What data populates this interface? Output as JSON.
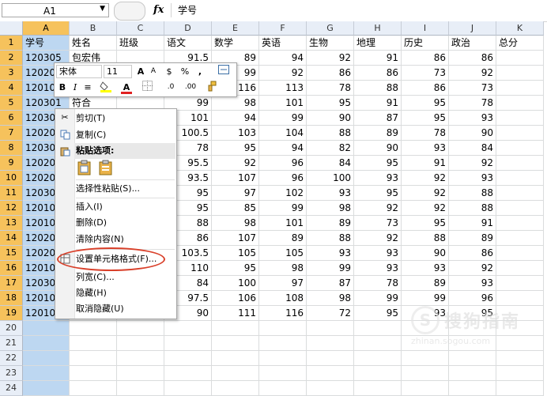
{
  "formula_bar": {
    "name_box": "A1",
    "fx": "fx",
    "content": "学号"
  },
  "columns": [
    "A",
    "B",
    "C",
    "D",
    "E",
    "F",
    "G",
    "H",
    "I",
    "J",
    "K"
  ],
  "rows": [
    "1",
    "2",
    "3",
    "4",
    "5",
    "6",
    "7",
    "8",
    "9",
    "10",
    "11",
    "12",
    "13",
    "14",
    "15",
    "16",
    "17",
    "18",
    "19",
    "20",
    "21",
    "22",
    "23",
    "24"
  ],
  "cells": [
    [
      "学号",
      "姓名",
      "班级",
      "语文",
      "数学",
      "英语",
      "生物",
      "地理",
      "历史",
      "政治",
      "总分"
    ],
    [
      "120305",
      "包宏伟",
      "",
      "91.5",
      "89",
      "94",
      "92",
      "91",
      "86",
      "86",
      ""
    ],
    [
      "120203",
      "",
      "",
      "93",
      "99",
      "92",
      "86",
      "86",
      "73",
      "92",
      ""
    ],
    [
      "120104",
      "",
      "",
      "102",
      "116",
      "113",
      "78",
      "88",
      "86",
      "73",
      ""
    ],
    [
      "120301",
      "符合",
      "",
      "99",
      "98",
      "101",
      "95",
      "91",
      "95",
      "78",
      ""
    ],
    [
      "120306",
      "",
      "",
      "101",
      "94",
      "99",
      "90",
      "87",
      "95",
      "93",
      ""
    ],
    [
      "120206",
      "",
      "",
      "100.5",
      "103",
      "104",
      "88",
      "89",
      "78",
      "90",
      ""
    ],
    [
      "120302",
      "",
      "",
      "78",
      "95",
      "94",
      "82",
      "90",
      "93",
      "84",
      ""
    ],
    [
      "120204",
      "",
      "",
      "95.5",
      "92",
      "96",
      "84",
      "95",
      "91",
      "92",
      ""
    ],
    [
      "120201",
      "",
      "",
      "93.5",
      "107",
      "96",
      "100",
      "93",
      "92",
      "93",
      ""
    ],
    [
      "120304",
      "",
      "",
      "95",
      "97",
      "102",
      "93",
      "95",
      "92",
      "88",
      ""
    ],
    [
      "120103",
      "",
      "",
      "95",
      "85",
      "99",
      "98",
      "92",
      "92",
      "88",
      ""
    ],
    [
      "120105",
      "",
      "",
      "88",
      "98",
      "101",
      "89",
      "73",
      "95",
      "91",
      ""
    ],
    [
      "120202",
      "",
      "",
      "86",
      "107",
      "89",
      "88",
      "92",
      "88",
      "89",
      ""
    ],
    [
      "120205",
      "",
      "",
      "103.5",
      "105",
      "105",
      "93",
      "93",
      "90",
      "86",
      ""
    ],
    [
      "120102",
      "",
      "",
      "110",
      "95",
      "98",
      "99",
      "93",
      "93",
      "92",
      ""
    ],
    [
      "120303",
      "",
      "",
      "84",
      "100",
      "97",
      "87",
      "78",
      "89",
      "93",
      ""
    ],
    [
      "120101",
      "",
      "",
      "97.5",
      "106",
      "108",
      "98",
      "99",
      "99",
      "96",
      ""
    ],
    [
      "120106",
      "",
      "",
      "90",
      "111",
      "116",
      "72",
      "95",
      "93",
      "95",
      ""
    ]
  ],
  "mini_toolbar": {
    "font_name": "宋体",
    "font_size": "11",
    "grow": "A",
    "shrink": "A",
    "currency": "$",
    "percent": "%",
    "comma": ",",
    "bold": "B",
    "italic": "I",
    "font_color_letter": "A",
    "dec_inc": ".0",
    "dec_dec": ".00",
    "highlight_color": "#ffff00",
    "font_color": "#e02020"
  },
  "context_menu": {
    "items": [
      "剪切(T)",
      "复制(C)",
      "粘贴选项:",
      "选择性粘贴(S)...",
      "插入(I)",
      "删除(D)",
      "清除内容(N)",
      "设置单元格格式(F)...",
      "列宽(C)...",
      "隐藏(H)",
      "取消隐藏(U)"
    ]
  },
  "watermark": {
    "text": "搜狗指南",
    "url": "zhinan.sogou.com"
  },
  "colors": {
    "header_bg": "#e8eef7",
    "selected_header": "#f6c25c",
    "selected_column": "#bdd7f1",
    "highlight_oval": "#d9402a"
  }
}
